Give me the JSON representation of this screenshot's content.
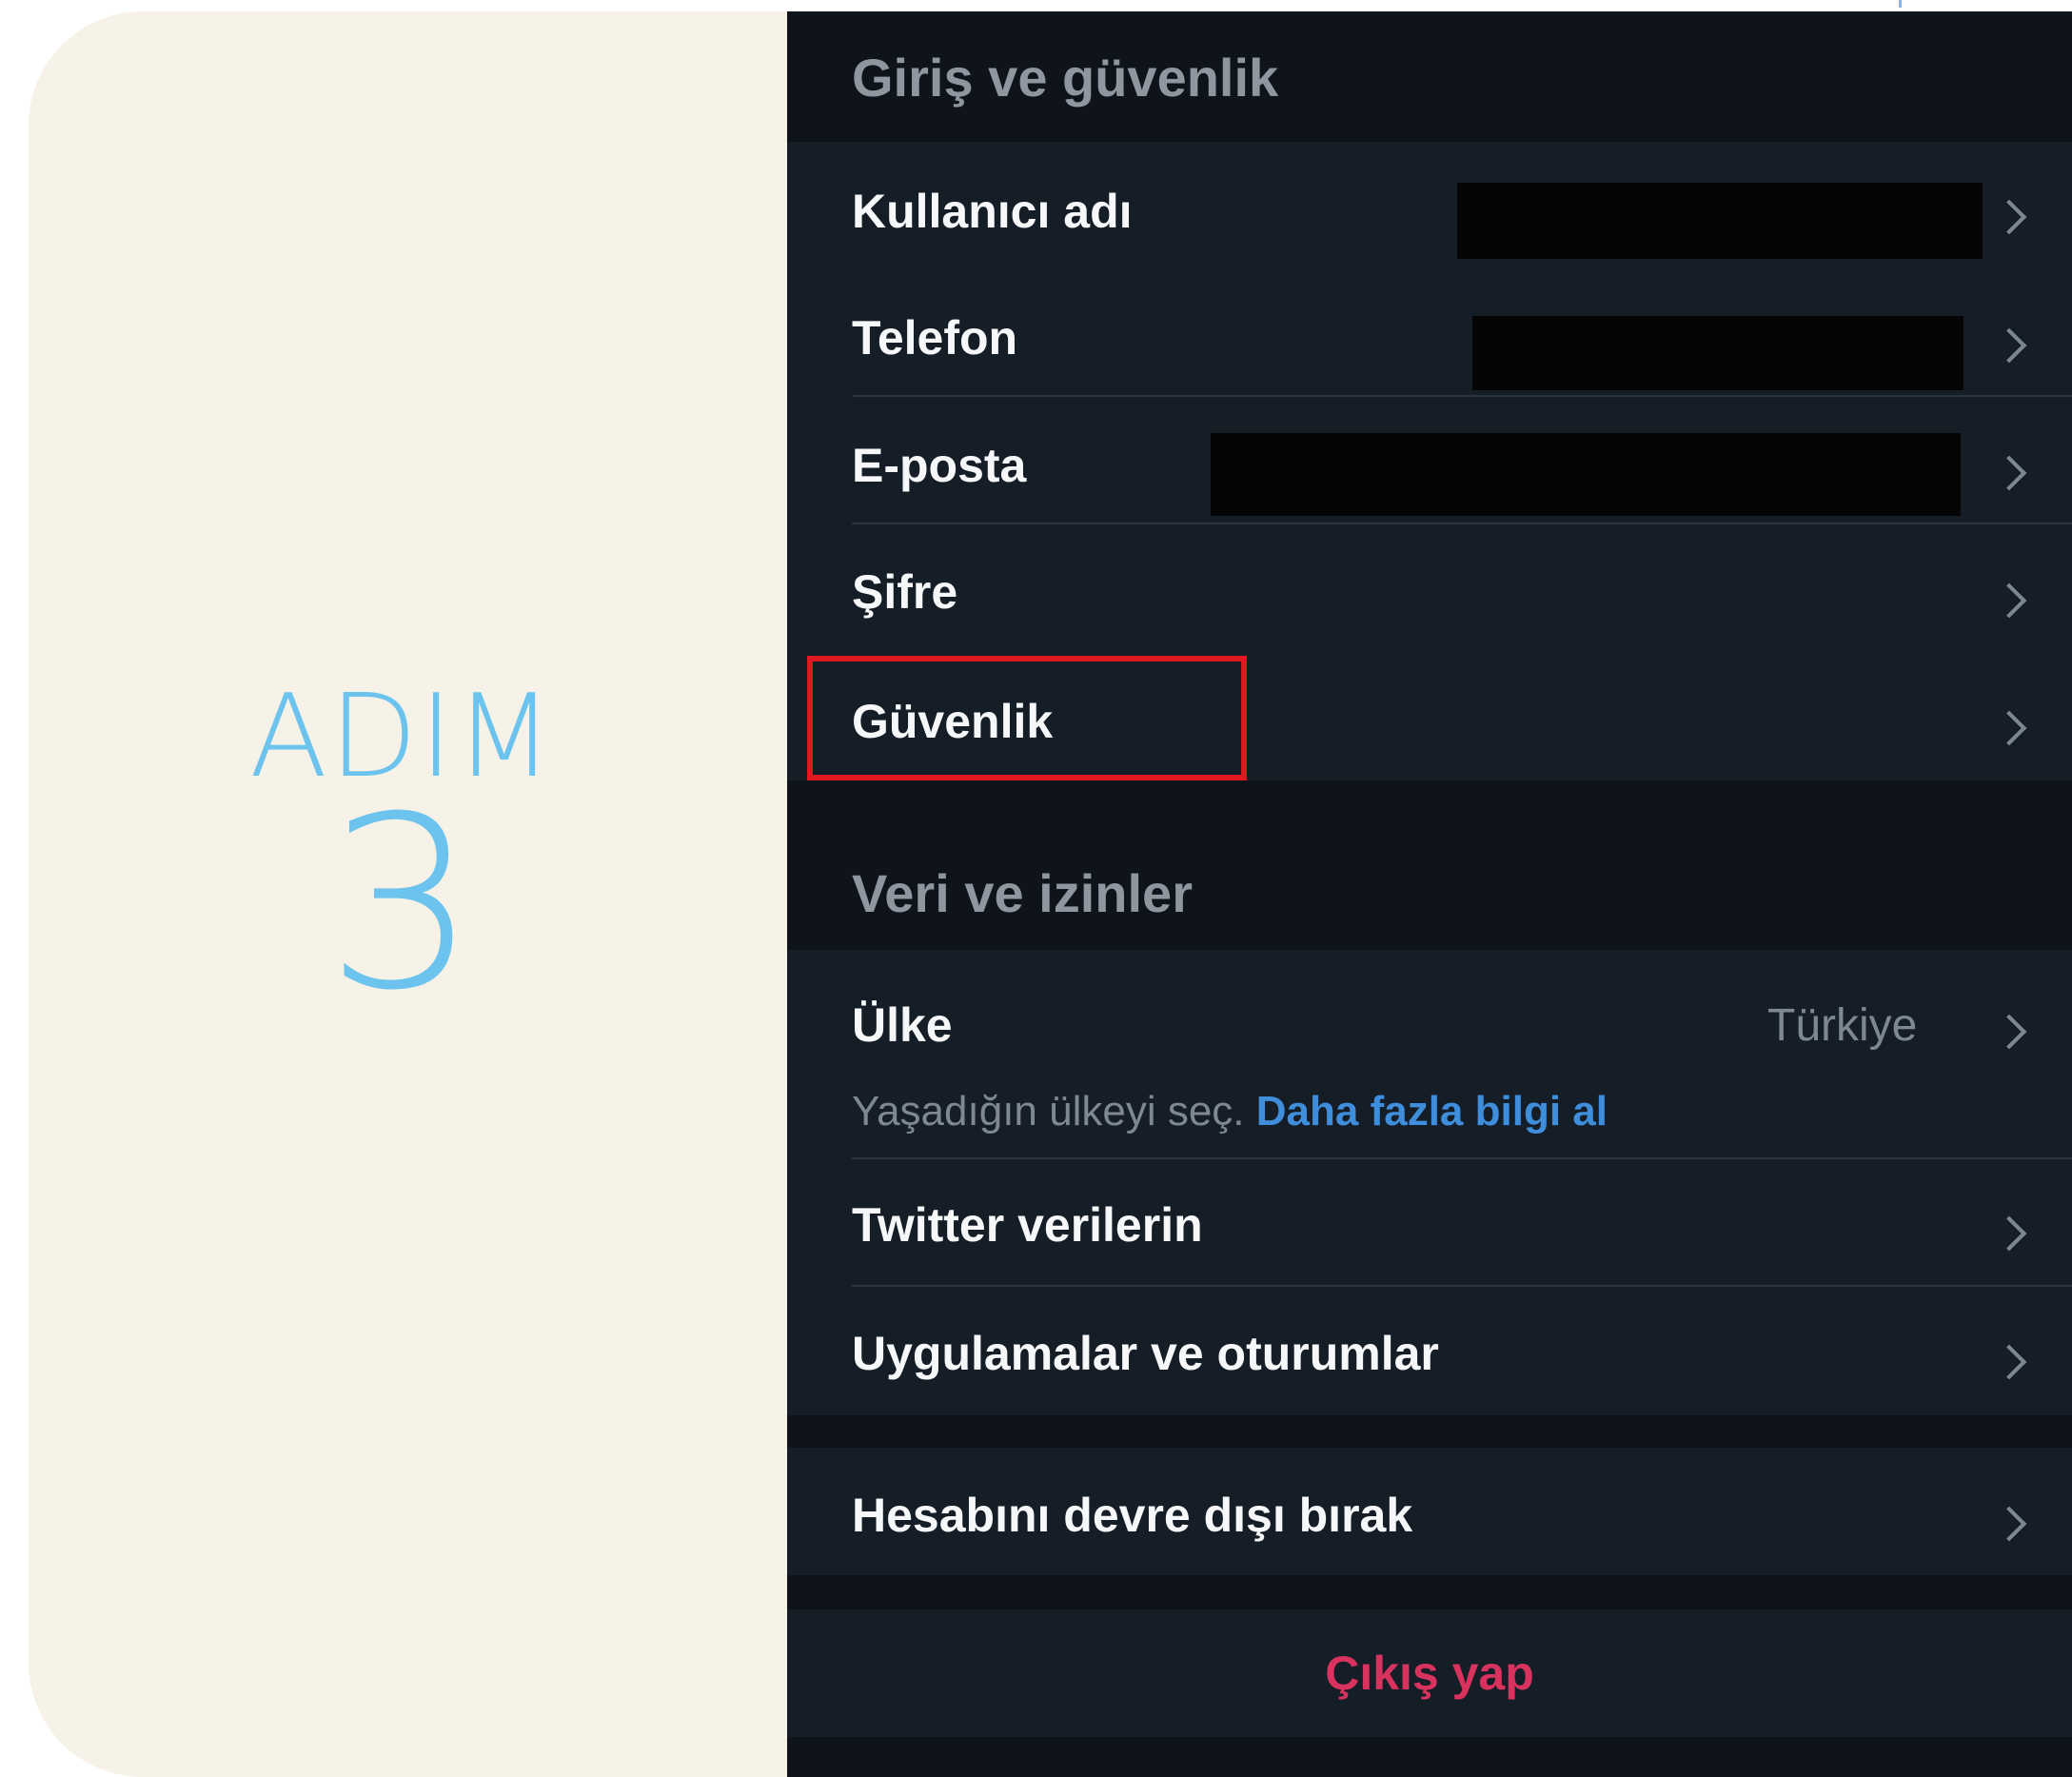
{
  "step": {
    "word": "ADIM",
    "number": "3"
  },
  "sections": {
    "login_security": {
      "title": "Giriş ve güvenlik"
    },
    "data_permissions": {
      "title": "Veri ve izinler"
    }
  },
  "rows": {
    "username": {
      "label": "Kullanıcı adı"
    },
    "phone": {
      "label": "Telefon"
    },
    "email": {
      "label": "E-posta"
    },
    "password": {
      "label": "Şifre"
    },
    "security": {
      "label": "Güvenlik"
    },
    "country": {
      "label": "Ülke",
      "value": "Türkiye",
      "help": "Yaşadığın ülkeyi seç.",
      "help_link": "Daha fazla bilgi al"
    },
    "twitter_data": {
      "label": "Twitter verilerin"
    },
    "apps_sessions": {
      "label": "Uygulamalar ve oturumlar"
    },
    "deactivate": {
      "label": "Hesabını devre dışı bırak"
    }
  },
  "logout": {
    "label": "Çıkış yap"
  },
  "colors": {
    "accent_step": "#6cc4ee",
    "highlight": "#e0181f",
    "logout": "#d8325f",
    "link": "#3f8edc",
    "panel_bg": "#151d27"
  },
  "icons": {
    "row_chevron": "chevron-right-icon"
  }
}
